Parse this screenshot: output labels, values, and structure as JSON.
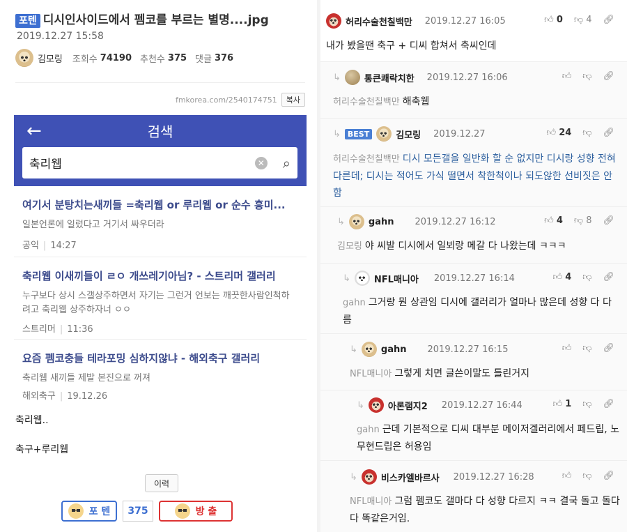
{
  "post": {
    "badge": "포텐",
    "title": "디시인사이드에서 펨코를 부르는 별명....jpg",
    "date": "2019.12.27 15:58",
    "author": "김모링",
    "views_label": "조회수",
    "views": "74190",
    "recommends_label": "추천수",
    "recommends": "375",
    "comments_label": "댓글",
    "comments": "376",
    "url": "fmkorea.com/2540174751",
    "copy_label": "복사"
  },
  "screenshot": {
    "header_title": "검색",
    "search_query": "축리웹",
    "results": [
      {
        "title": "여기서 분탕치는새끼들 =축리웹 or 루리웹 or 순수 흥미...",
        "body": "일본언론에 일렀다고 거기서 싸우더라",
        "source": "공익",
        "time": "14:27"
      },
      {
        "title": "축리웹 이새끼들이 ㄹㅇ 개쓰레기아님? - 스트리머 갤러리",
        "body": "누구보다 상시 스갤상주하면서 자기는 그런거 언보는 깨끗한사람인척하려고 축리웹 상주하자너 ㅇㅇ",
        "source": "스트리머",
        "time": "11:36"
      },
      {
        "title": "요즘 펨코충들 테라포밍 심하지않냐 - 해외축구 갤러리",
        "body": "축리웹 새끼들 제발 본진으로 꺼져",
        "source": "해외축구",
        "time": "19.12.26"
      }
    ]
  },
  "body": {
    "line1": "축리웹..",
    "line2": "축구+루리웹"
  },
  "footer": {
    "history_label": "이력",
    "up_label": "포 텐",
    "count": "375",
    "down_label": "방 출"
  },
  "comments": [
    {
      "nick": "허리수술천칠백만",
      "date": "2019.12.27 16:05",
      "up": "0",
      "down": "4",
      "to": "",
      "text": "내가 봤을땐 축구 + 디씨 합쳐서 축씨인데"
    },
    {
      "nick": "통큰쾌락치한",
      "date": "2019.12.27 16:06",
      "up": "",
      "down": "",
      "to": "허리수술천칠백만",
      "text": "해축웹"
    },
    {
      "badge": "BEST",
      "nick": "김모링",
      "date": "2019.12.27",
      "up": "24",
      "down": "",
      "to": "허리수술천칠백만",
      "text": "디시 모든갤을 일반화 할 순 없지만 디시랑 성향 전혀 다른데; 디시는 적어도 가식 떨면서 착한척이나 되도않한 선비짓은 안함"
    },
    {
      "nick": "gahn",
      "date": "2019.12.27 16:12",
      "up": "4",
      "down": "8",
      "to": "김모링",
      "text": "야 씨발 디시에서 일뵈랑 메갈 다 나왔는데 ㅋㅋㅋ"
    },
    {
      "nick": "NFL매니아",
      "date": "2019.12.27 16:14",
      "up": "4",
      "down": "",
      "to": "gahn",
      "text": "그거랑 뭔 상관임 디시에 갤러리가 얼마나 많은데 성향 다 다름"
    },
    {
      "nick": "gahn",
      "date": "2019.12.27 16:15",
      "up": "",
      "down": "",
      "to": "NFL매니아",
      "text": "그렇게 치면 글쓴이말도 틀린거지"
    },
    {
      "nick": "아론램지2",
      "date": "2019.12.27 16:44",
      "up": "1",
      "down": "",
      "to": "gahn",
      "text": "근데 기본적으로 디씨 대부분 메이저겔러리에서 페드립, 노무현드립은 허용임"
    },
    {
      "nick": "비스카엘바르사",
      "date": "2019.12.27 16:28",
      "up": "",
      "down": "",
      "to": "NFL매니아",
      "text": "그럼 펨코도 갤마다 다 성향 다르지 ㅋㅋ 결국 돌고 돌다 다 똑같은거임."
    }
  ],
  "icons": {
    "thumb_up": "thumbs-up-icon",
    "thumb_down": "thumbs-down-icon",
    "link": "link-icon",
    "reply": "reply-arrow-icon"
  },
  "colors": {
    "accent": "#3d6fd1",
    "search_header": "#3f51b5",
    "best_text": "#2c5f9e",
    "down": "#d33"
  }
}
